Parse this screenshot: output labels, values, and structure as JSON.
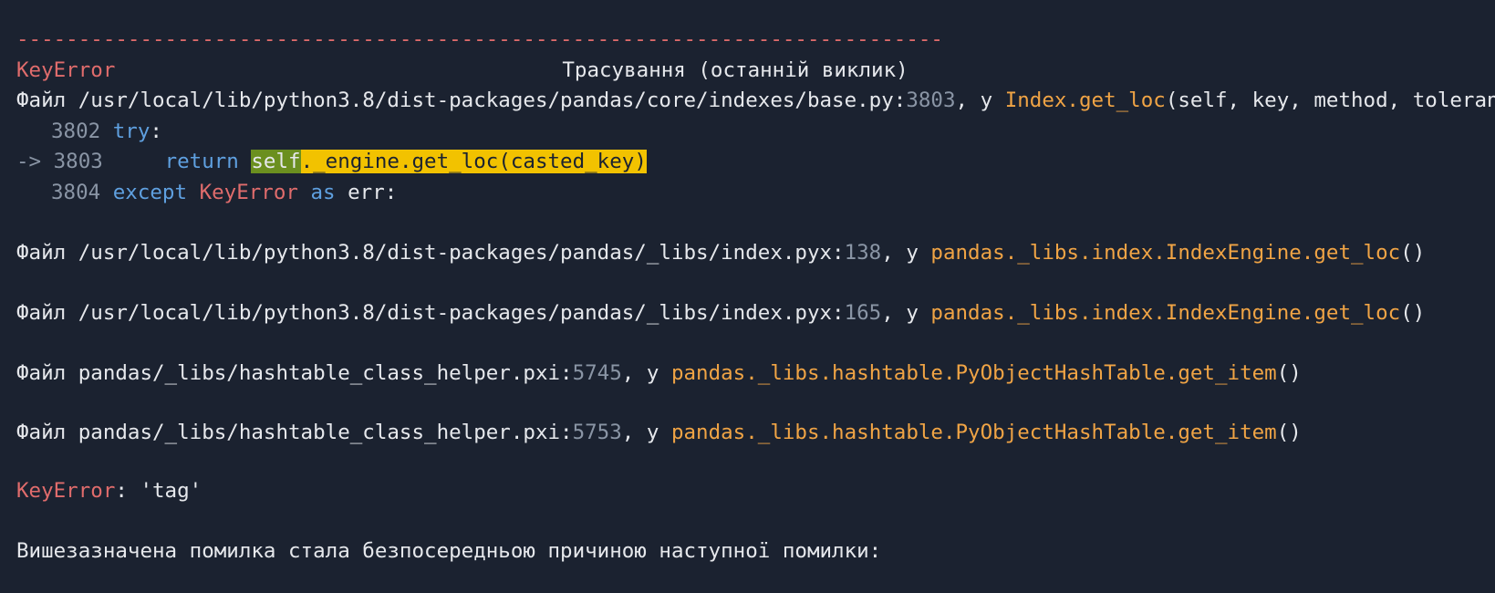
{
  "traceback": {
    "separator": "---------------------------------------------------------------------------",
    "header": {
      "error_name": "KeyError",
      "title": "Трасування (останній виклик)"
    },
    "frame1": {
      "prefix": "Файл /usr/local/lib/python3.8/dist-packages/pandas/core/indexes/base.py:",
      "line_no": "3803",
      "in_word": ", у ",
      "func": "Index.get_loc",
      "args": "(self, key, method, tolerance)",
      "code": [
        {
          "arrow": "",
          "num": "3802",
          "keyword": "try",
          "rest": ":"
        },
        {
          "arrow": "->",
          "num": "3803",
          "keyword": "return",
          "hl_self": "self",
          "hl_rest": "._engine.get_loc(casted_key)"
        },
        {
          "arrow": "",
          "num": "3804",
          "keyword": "except",
          "error": "KeyError",
          "as_kw": "as",
          "rest": " err:"
        }
      ]
    },
    "frame2": {
      "prefix": "Файл /usr/local/lib/python3.8/dist-packages/pandas/_libs/index.pyx:",
      "line_no": "138",
      "in_word": ", у ",
      "func": "pandas._libs.index.IndexEngine.get_loc",
      "args": "()"
    },
    "frame3": {
      "prefix": "Файл /usr/local/lib/python3.8/dist-packages/pandas/_libs/index.pyx:",
      "line_no": "165",
      "in_word": ", у ",
      "func": "pandas._libs.index.IndexEngine.get_loc",
      "args": "()"
    },
    "frame4": {
      "prefix": "Файл pandas/_libs/hashtable_class_helper.pxi:",
      "line_no": "5745",
      "in_word": ", у ",
      "func": "pandas._libs.hashtable.PyObjectHashTable.get_item",
      "args": "()"
    },
    "frame5": {
      "prefix": "Файл pandas/_libs/hashtable_class_helper.pxi:",
      "line_no": "5753",
      "in_word": ", у ",
      "func": "pandas._libs.hashtable.PyObjectHashTable.get_item",
      "args": "()"
    },
    "final_error": {
      "name": "KeyError",
      "message": ": 'tag'"
    },
    "chained_message": "Вишезазначена помилка стала безпосередньою причиною наступної помилки:"
  }
}
